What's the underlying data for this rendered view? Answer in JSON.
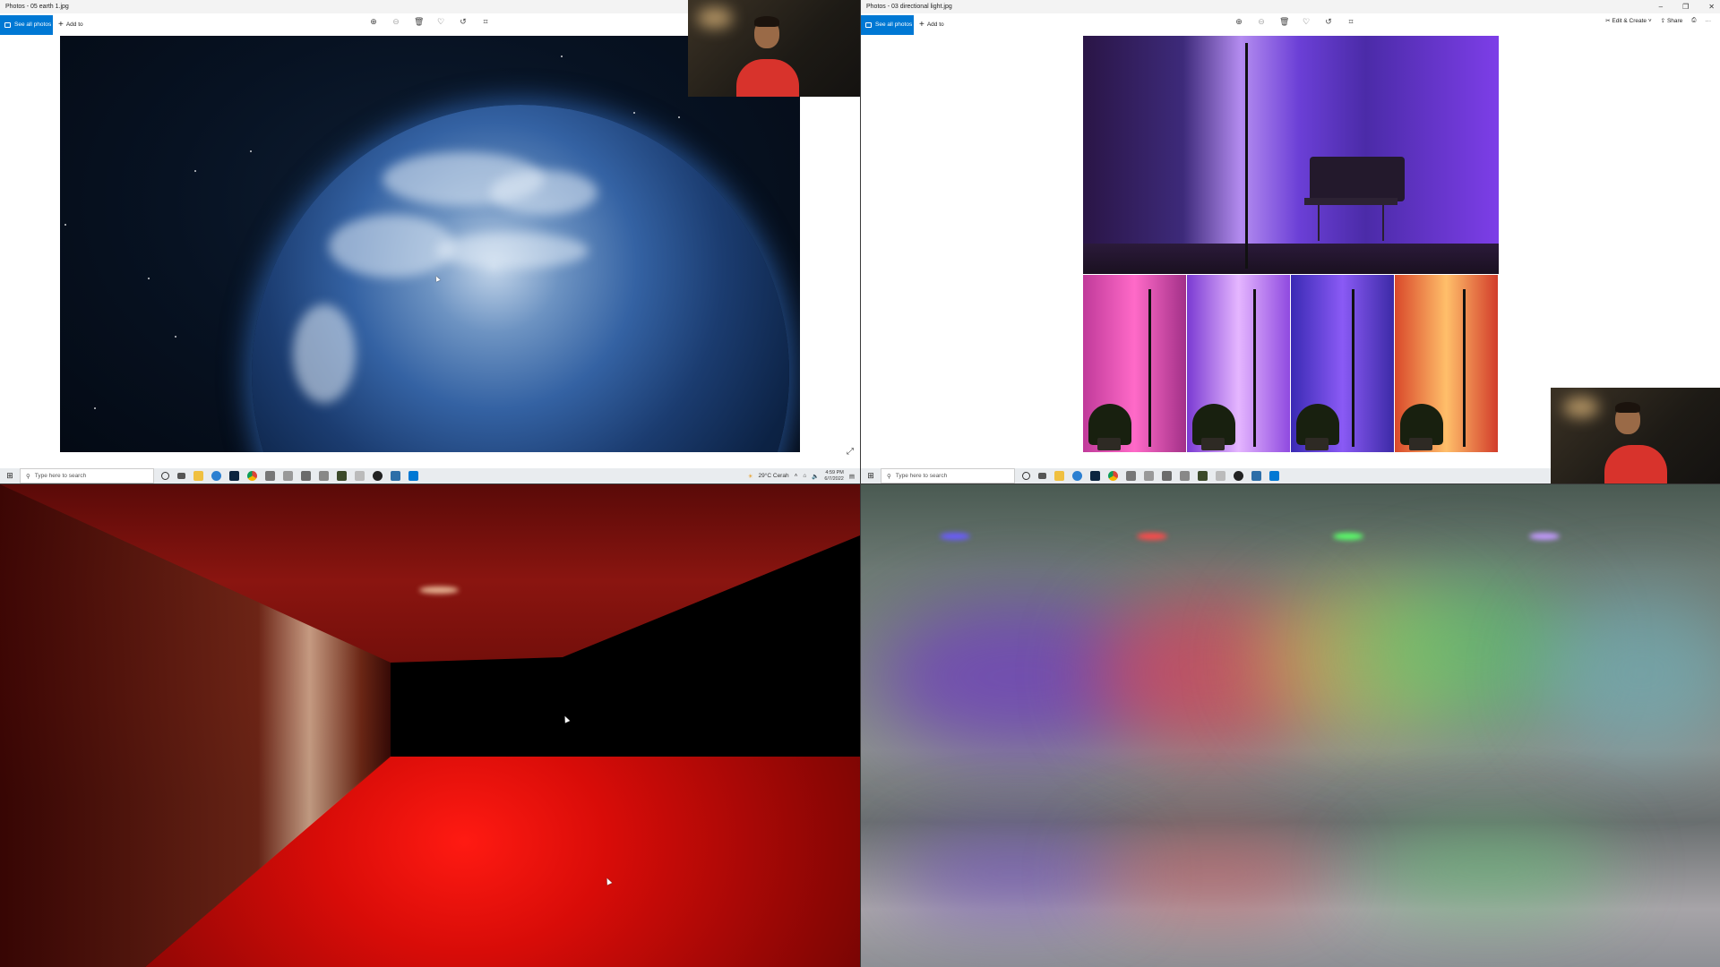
{
  "top_left": {
    "title": "Photos - 05 earth 1.jpg",
    "see_all_label": "See all photos",
    "add_to_label": "Add to",
    "tool_icons": [
      "zoom-in-icon",
      "zoom-out-icon",
      "delete-icon",
      "heart-icon",
      "rotate-icon",
      "crop-icon"
    ]
  },
  "top_right": {
    "title": "Photos - 03 directional light.jpg",
    "see_all_label": "See all photos",
    "add_to_label": "Add to",
    "edit_create_label": "Edit & Create",
    "share_label": "Share",
    "tool_icons": [
      "zoom-in-icon",
      "zoom-out-icon",
      "delete-icon",
      "heart-icon",
      "rotate-icon",
      "crop-icon"
    ]
  },
  "taskbar_left": {
    "search_placeholder": "Type here to search",
    "weather": "29°C  Cerah",
    "time": "4:59 PM",
    "date": "6/7/2022"
  },
  "taskbar_right": {
    "search_placeholder": "Type here to search"
  },
  "colors": {
    "accent": "#0078d4",
    "webcam_shirt": "#d8332c"
  }
}
